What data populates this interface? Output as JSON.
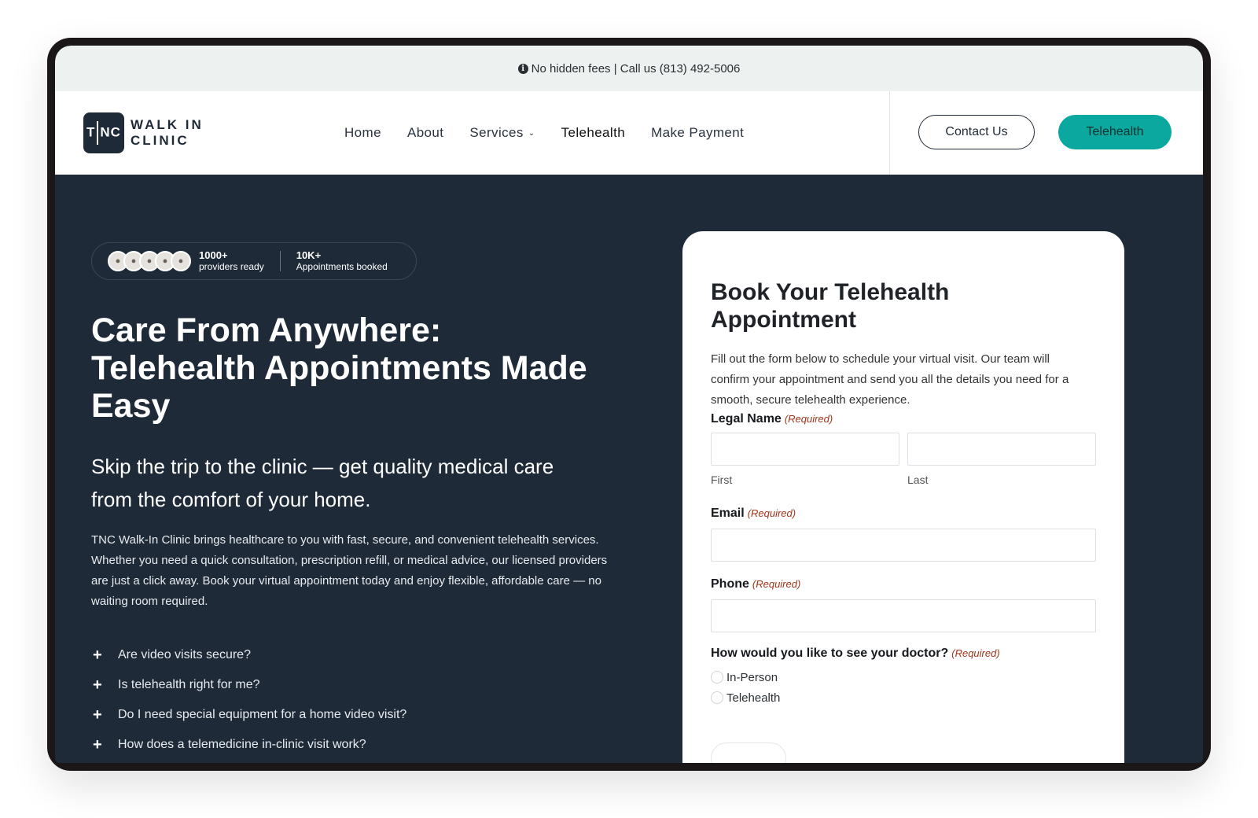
{
  "topbar": {
    "text": "No hidden fees | Call us (813) 492-5006",
    "icon": "info-icon"
  },
  "logo": {
    "mark": "TNC",
    "line1": "WALK IN",
    "line2": "CLINIC"
  },
  "nav": {
    "items": [
      {
        "label": "Home"
      },
      {
        "label": "About"
      },
      {
        "label": "Services",
        "has_dropdown": true
      },
      {
        "label": "Telehealth",
        "active": true
      },
      {
        "label": "Make Payment"
      }
    ],
    "contact_label": "Contact Us",
    "telehealth_label": "Telehealth"
  },
  "stats": {
    "providers_num": "1000+",
    "providers_label": "providers ready",
    "appointments_num": "10K+",
    "appointments_label": "Appointments booked"
  },
  "hero": {
    "title_strong": "Care From Anywhere:",
    "title_rest": "Telehealth Appointments Made Easy",
    "subtitle": "Skip the trip to the clinic — get quality medical care from the comfort of your home.",
    "body": "TNC Walk-In Clinic brings healthcare to you with fast, secure, and convenient telehealth services. Whether you need a quick consultation, prescription refill, or medical advice, our licensed providers are just a click away. Book your virtual appointment today and enjoy flexible, affordable care — no waiting room required."
  },
  "faq": [
    "Are video visits secure?",
    "Is telehealth right for me?",
    "Do I need special equipment for a home video visit?",
    "How does a telemedicine in-clinic visit work?"
  ],
  "form": {
    "title": "Book Your Telehealth Appointment",
    "intro": "Fill out the form below to schedule your virtual visit. Our team will confirm your appointment and send you all the details you need for a smooth, secure telehealth experience.",
    "required": "(Required)",
    "legal_name": "Legal Name",
    "first": "First",
    "last": "Last",
    "email": "Email",
    "phone": "Phone",
    "visit_question": "How would you like to see your doctor?",
    "options": [
      "In-Person",
      "Telehealth"
    ]
  },
  "colors": {
    "accent": "#0aa89e",
    "dark": "#1f2a38",
    "required": "#a0341a"
  }
}
